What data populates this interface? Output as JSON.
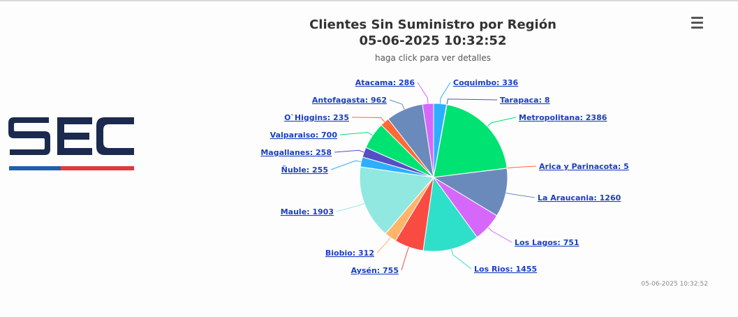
{
  "chart_data": {
    "type": "pie",
    "title": "Clientes Sin Suministro por Región",
    "title_datetime": "05-06-2025 10:32:52",
    "subtitle": "haga click para ver detalles",
    "slices": [
      {
        "label": "Coquimbo",
        "value": 336,
        "color": "#2caffe"
      },
      {
        "label": "Tarapaca",
        "value": 8,
        "color": "#544fc5"
      },
      {
        "label": "Metropolitana",
        "value": 2386,
        "color": "#00e272"
      },
      {
        "label": "Arica y Parinacota",
        "value": 5,
        "color": "#fe6a35"
      },
      {
        "label": "La Araucania",
        "value": 1260,
        "color": "#6b8abc"
      },
      {
        "label": "Los Lagos",
        "value": 751,
        "color": "#d568fb"
      },
      {
        "label": "Los Rios",
        "value": 1455,
        "color": "#2ee0ca"
      },
      {
        "label": "Aysén",
        "value": 755,
        "color": "#fa4b42"
      },
      {
        "label": "Biobio",
        "value": 312,
        "color": "#feb56a"
      },
      {
        "label": "Maule",
        "value": 1903,
        "color": "#91e8e1"
      },
      {
        "label": "Ñuble",
        "value": 255,
        "color": "#2caffe"
      },
      {
        "label": "Magallanes",
        "value": 258,
        "color": "#544fc5"
      },
      {
        "label": "Valparaiso",
        "value": 700,
        "color": "#00e272"
      },
      {
        "label": "O`Higgins",
        "value": 235,
        "color": "#fe6a35"
      },
      {
        "label": "Antofagasta",
        "value": 962,
        "color": "#6b8abc"
      },
      {
        "label": "Atacama",
        "value": 286,
        "color": "#d568fb"
      }
    ],
    "label_format": "{label}: {value}"
  },
  "credit": "05-06-2025 10:32:52",
  "logo": {
    "text": "SEC",
    "colors": {
      "navy": "#1b2a4e",
      "blue": "#1f5fae",
      "red": "#e0393e"
    }
  },
  "menu": {
    "icon": "hamburger-menu-icon"
  }
}
